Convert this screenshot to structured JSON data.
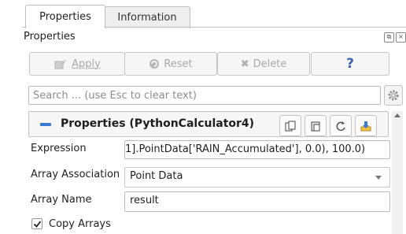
{
  "tabs": [
    {
      "label": "Properties",
      "active": true
    },
    {
      "label": "Information",
      "active": false
    }
  ],
  "panel": {
    "title": "Properties"
  },
  "toolbar": {
    "apply_label": "Apply",
    "reset_label": "Reset",
    "delete_label": "Delete",
    "help_label": "?"
  },
  "search": {
    "placeholder": "Search ... (use Esc to clear text)",
    "value": ""
  },
  "section": {
    "title": "Properties (PythonCalculator4)"
  },
  "properties": {
    "expression": {
      "label": "Expression",
      "value": "1].PointData['RAIN_Accumulated'], 0.0), 100.0)"
    },
    "array_association": {
      "label": "Array Association",
      "value": "Point Data"
    },
    "array_name": {
      "label": "Array Name",
      "value": "result"
    },
    "copy_arrays": {
      "label": "Copy Arrays",
      "checked": true
    }
  },
  "colors": {
    "accent": "#3a7ad0",
    "disabled_text": "#a8a8a8",
    "help": "#3a62b8"
  },
  "icons": [
    "apply-icon",
    "reset-icon",
    "delete-icon",
    "help-icon",
    "gear-icon",
    "copy-icon",
    "paste-icon",
    "restore-default-icon",
    "save-icon"
  ]
}
